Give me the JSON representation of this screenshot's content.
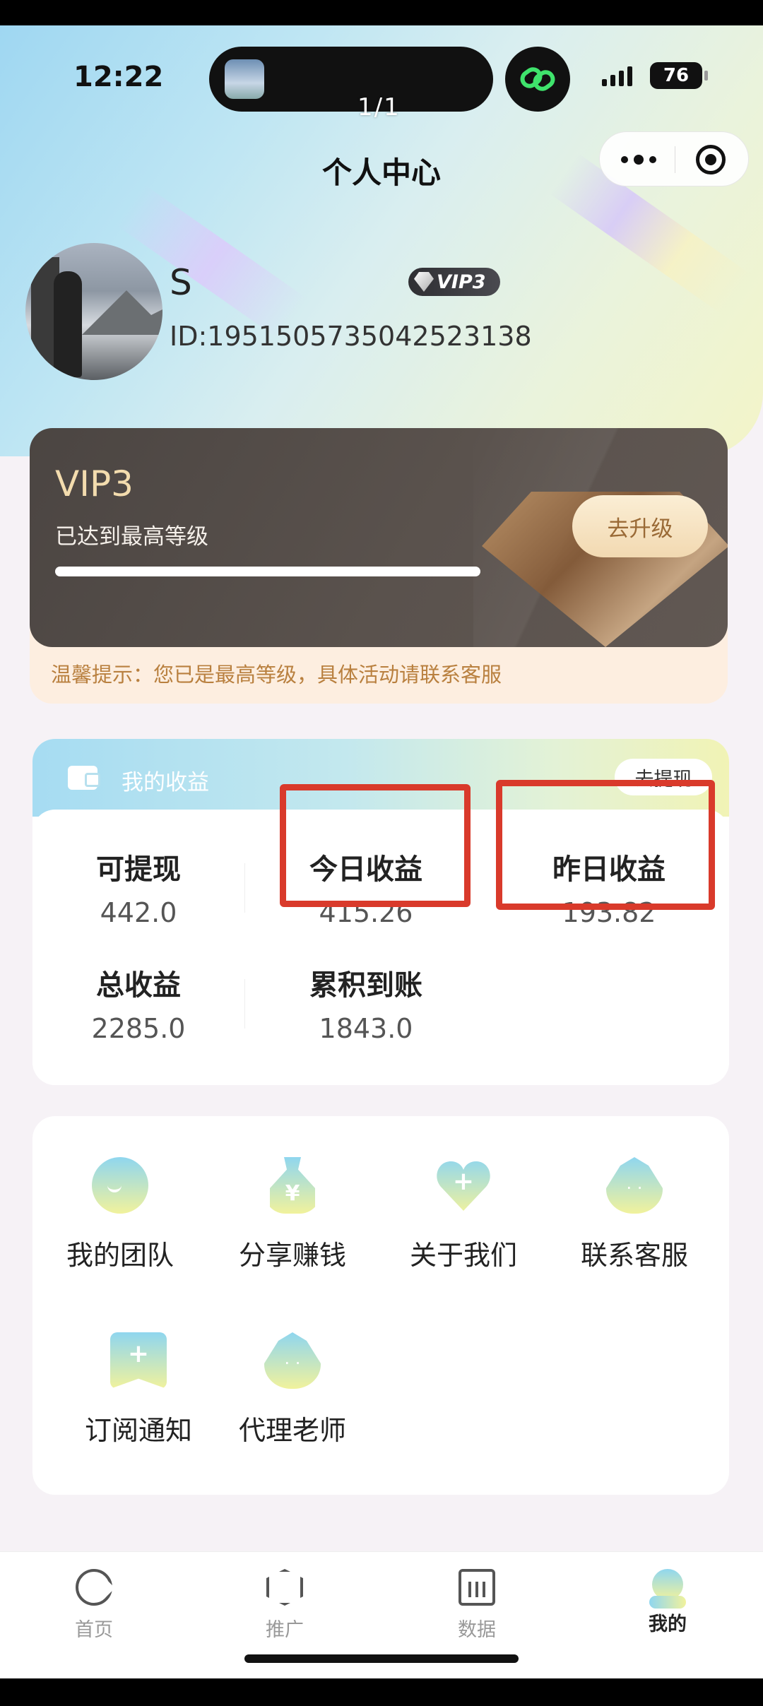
{
  "status_bar": {
    "time": "12:22",
    "battery": "76",
    "page_counter": "1/1"
  },
  "header": {
    "title": "个人中心"
  },
  "profile": {
    "name": "S",
    "vip_badge": "VIP3",
    "id_text": "ID:1951505735042523138"
  },
  "vip_card": {
    "level": "VIP3",
    "status": "已达到最高等级",
    "progress": 1.0,
    "upgrade_button": "去升级",
    "tip": "温馨提示：您已是最高等级，具体活动请联系客服"
  },
  "earnings": {
    "title": "我的收益",
    "withdraw_button": "去提现",
    "stats": [
      {
        "label": "可提现",
        "value": "442.0"
      },
      {
        "label": "今日收益",
        "value": "415.26"
      },
      {
        "label": "昨日收益",
        "value": "193.82"
      },
      {
        "label": "总收益",
        "value": "2285.0"
      },
      {
        "label": "累积到账",
        "value": "1843.0"
      }
    ]
  },
  "menu": [
    {
      "label": "我的团队",
      "icon": "team-icon"
    },
    {
      "label": "分享赚钱",
      "icon": "money-bag-icon"
    },
    {
      "label": "关于我们",
      "icon": "heart-plus-icon"
    },
    {
      "label": "联系客服",
      "icon": "chat-drop-icon"
    },
    {
      "label": "订阅通知",
      "icon": "bookmark-plus-icon"
    },
    {
      "label": "代理老师",
      "icon": "teacher-drop-icon"
    }
  ],
  "tabbar": [
    {
      "label": "首页",
      "icon": "home-icon",
      "active": false
    },
    {
      "label": "推广",
      "icon": "cube-icon",
      "active": false
    },
    {
      "label": "数据",
      "icon": "chart-icon",
      "active": false
    },
    {
      "label": "我的",
      "icon": "profile-icon",
      "active": true
    }
  ],
  "colors": {
    "highlight": "#d93a2b",
    "vip_gold": "#f3dcae",
    "tip_text": "#b9803f"
  }
}
